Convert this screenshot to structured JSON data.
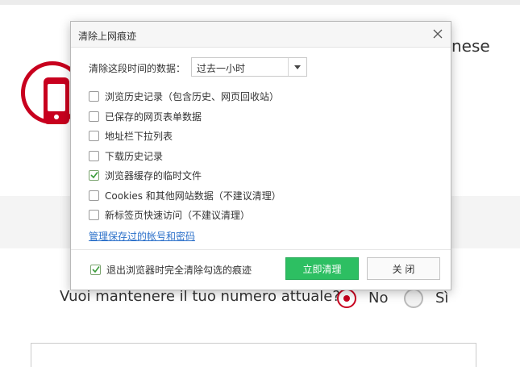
{
  "background": {
    "title_fragment": "nese",
    "question": "Vuoi mantenere il tuo numero attuale?",
    "options": [
      {
        "label": "No",
        "selected": true
      },
      {
        "label": "Sì",
        "selected": false
      }
    ],
    "accent_color": "#c8001e"
  },
  "dialog": {
    "title": "清除上网痕迹",
    "time_range": {
      "label": "清除这段时间的数据：",
      "selected": "过去一小时"
    },
    "items": [
      {
        "label": "浏览历史记录（包含历史、网页回收站）",
        "checked": false
      },
      {
        "label": "已保存的网页表单数据",
        "checked": false
      },
      {
        "label": "地址栏下拉列表",
        "checked": false
      },
      {
        "label": "下载历史记录",
        "checked": false
      },
      {
        "label": "浏览器缓存的临时文件",
        "checked": true
      },
      {
        "label": "Cookies 和其他网站数据（不建议清理）",
        "checked": false
      },
      {
        "label": "新标签页快速访问（不建议清理）",
        "checked": false
      }
    ],
    "manage_link": "管理保存过的帐号和密码",
    "footer_option": {
      "label": "退出浏览器时完全清除勾选的痕迹",
      "checked": true
    },
    "buttons": {
      "confirm": "立即清理",
      "close": "关 闭"
    },
    "confirm_color": "#2dbf62"
  }
}
